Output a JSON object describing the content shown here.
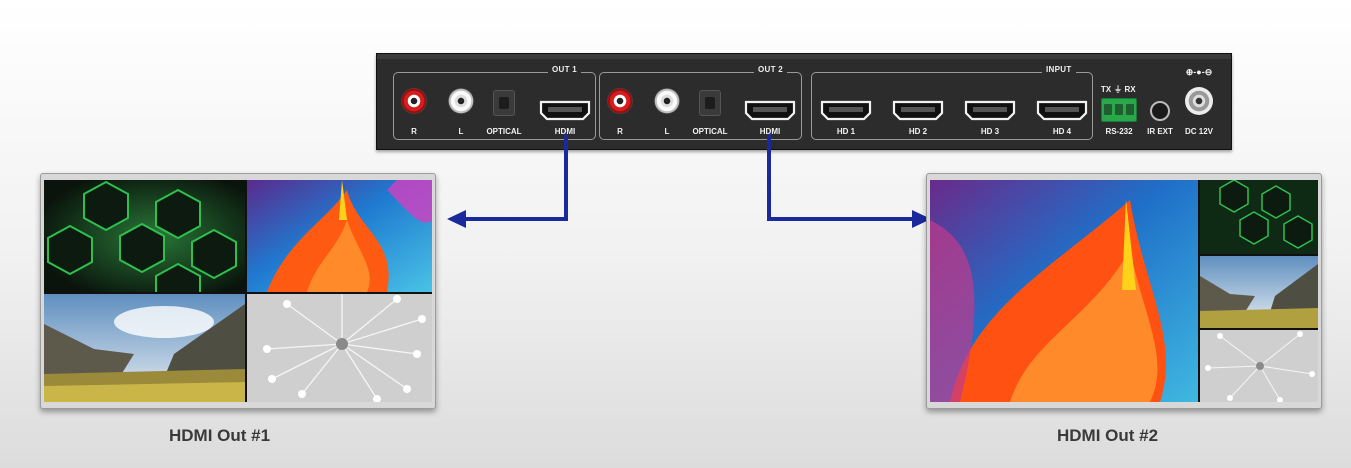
{
  "device": {
    "out1": {
      "title": "OUT 1",
      "labels": {
        "r": "R",
        "l": "L",
        "optical": "OPTICAL",
        "hdmi": "HDMI"
      }
    },
    "out2": {
      "title": "OUT 2",
      "labels": {
        "r": "R",
        "l": "L",
        "optical": "OPTICAL",
        "hdmi": "HDMI"
      }
    },
    "input": {
      "title": "INPUT",
      "ports": [
        "HD 1",
        "HD 2",
        "HD 3",
        "HD 4"
      ]
    },
    "rs232": {
      "tx": "TX",
      "gnd": "⏚",
      "rx": "RX",
      "label": "RS-232"
    },
    "ir_ext": "IR EXT",
    "dc": {
      "label": "DC 12V",
      "polarity": "⊕-●-⊖"
    }
  },
  "monitors": [
    {
      "caption": "HDMI Out #1",
      "layout": "quad"
    },
    {
      "caption": "HDMI Out #2",
      "layout": "main-plus-three"
    }
  ],
  "colors": {
    "arrow": "#1a2a9c",
    "rca_red": "#d61c1c",
    "terminal_green": "#28a84a",
    "panel": "#2c2c2c"
  }
}
